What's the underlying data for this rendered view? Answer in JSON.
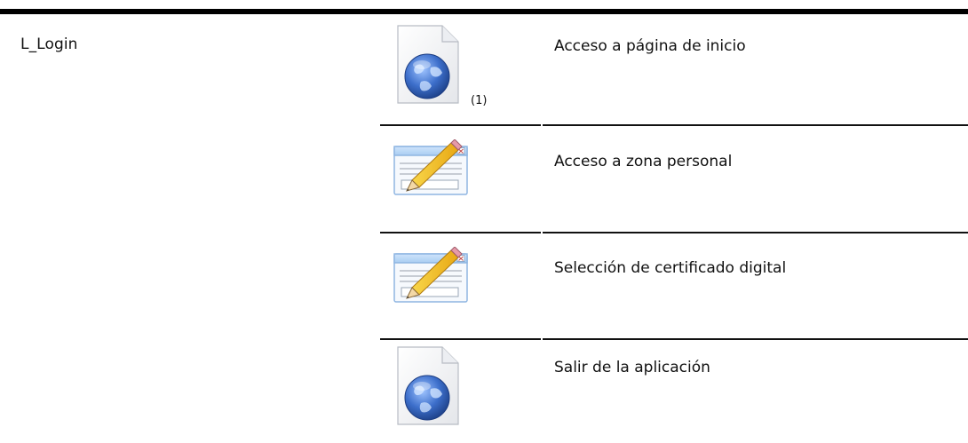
{
  "module": {
    "name": "L_Login"
  },
  "steps": [
    {
      "label": "Acceso a página de inicio",
      "icon": "web-page-globe-icon",
      "note": "(1)"
    },
    {
      "label": "Acceso a zona personal",
      "icon": "form-edit-pencil-icon"
    },
    {
      "label": "Selección de certificado digital",
      "icon": "form-edit-pencil-icon"
    },
    {
      "label": "Salir de la aplicación",
      "icon": "web-page-globe-icon"
    }
  ],
  "colors": {
    "rule": "#000000",
    "text": "#111111",
    "globe_blue": "#2f5fb3",
    "pencil_yellow": "#f4c51d"
  }
}
